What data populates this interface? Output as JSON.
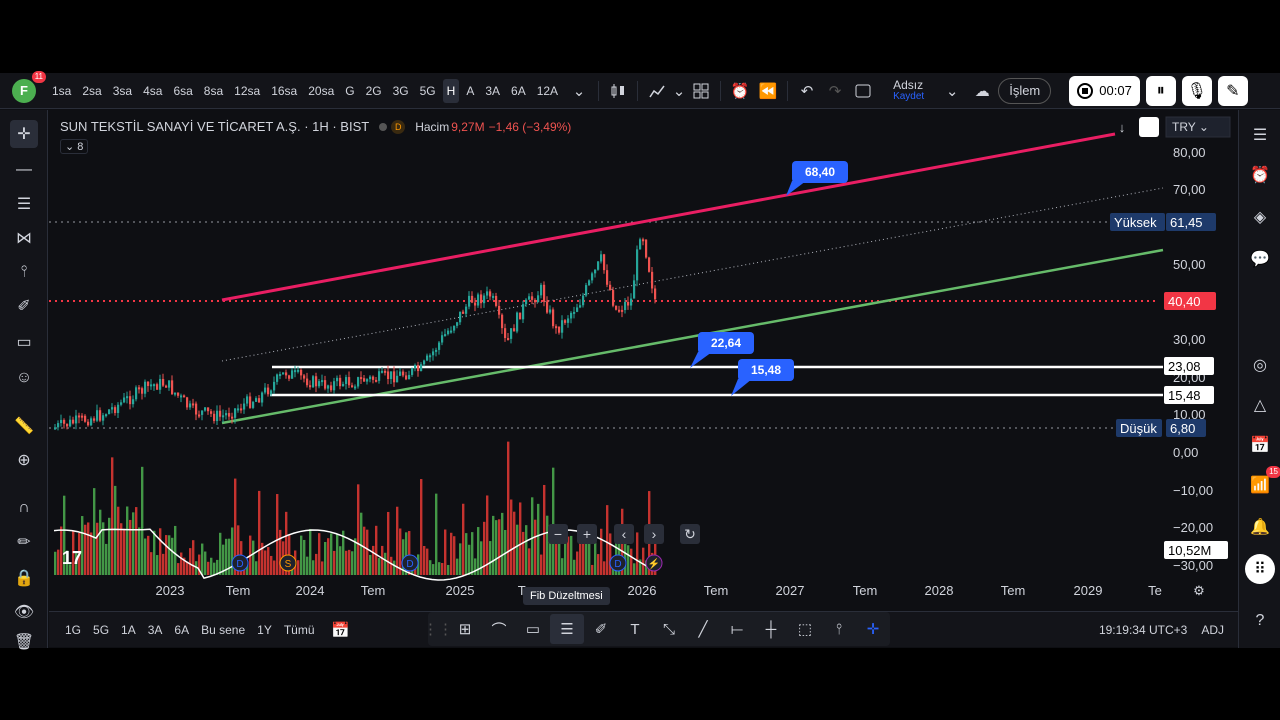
{
  "header": {
    "avatar_letter": "F",
    "avatar_badge": "11",
    "timeframes": [
      "1sa",
      "2sa",
      "3sa",
      "4sa",
      "6sa",
      "8sa",
      "12sa",
      "16sa",
      "20sa",
      "G",
      "2G",
      "3G",
      "5G",
      "H",
      "A",
      "3A",
      "6A",
      "12A"
    ],
    "active_timeframe": "H",
    "layout_name": "Adsız",
    "layout_sub": "Kaydet",
    "trade_label": "İşlem",
    "rec_time": "00:07"
  },
  "legend": {
    "symbol": "SUN TEKSTİL SANAYİ VE TİCARET A.Ş. · 1H · BIST",
    "volume_label": "Hacim",
    "volume_value": "9,27M",
    "change": "−1,46 (−3,49%)",
    "indicator_count": "8"
  },
  "currency": "TRY",
  "price_axis": {
    "labels": [
      "80,00",
      "70,00",
      "50,00",
      "30,00",
      "20,00",
      "10,00",
      "0,00",
      "−10,00",
      "−20,00",
      "−30,00"
    ],
    "tags": {
      "high_label": "Yüksek",
      "high": "61,45",
      "current": "40,40",
      "h1": "23,08",
      "h2": "15,48",
      "low_label": "Düşük",
      "low": "6,80",
      "vol": "10,52M"
    }
  },
  "time_axis": [
    "2023",
    "Tem",
    "2024",
    "Tem",
    "2025",
    "Tem",
    "2026",
    "Tem",
    "2027",
    "Tem",
    "2028",
    "Tem",
    "2029",
    "Te"
  ],
  "annotations": {
    "a1": "68,40",
    "a2": "22,64",
    "a3": "15,48"
  },
  "bottom": {
    "ranges": [
      "1G",
      "5G",
      "1A",
      "3A",
      "6A",
      "Bu sene",
      "1Y",
      "Tümü"
    ],
    "clock": "19:19:34 UTC+3",
    "adj": "ADJ"
  },
  "tooltip": "Fib Düzeltmesi",
  "colors": {
    "up": "#26a69a",
    "down": "#ef5350",
    "pitch_top": "#e91e63",
    "pitch_bottom": "#66bb6a",
    "accent": "#2962ff"
  },
  "rightbar_badge": "15"
}
